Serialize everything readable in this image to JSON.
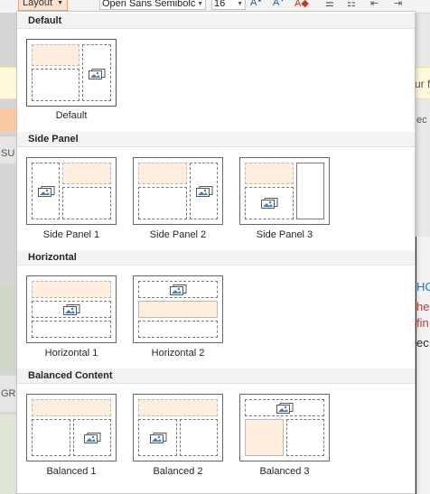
{
  "toolbar": {
    "layout_label": "Layout",
    "font_name": "Open Sans Semibolc",
    "font_size": "16"
  },
  "background": {
    "right_fragments": [
      "ur f",
      "ec",
      "HC",
      "he",
      "fin",
      "ec"
    ],
    "left_fragments": [
      "SU",
      "GR"
    ]
  },
  "gallery": {
    "sections": [
      {
        "title": "Default",
        "items": [
          {
            "label": "Default"
          }
        ]
      },
      {
        "title": "Side Panel",
        "items": [
          {
            "label": "Side Panel 1"
          },
          {
            "label": "Side Panel 2"
          },
          {
            "label": "Side Panel 3"
          }
        ]
      },
      {
        "title": "Horizontal",
        "items": [
          {
            "label": "Horizontal 1"
          },
          {
            "label": "Horizontal 2"
          }
        ]
      },
      {
        "title": "Balanced Content",
        "items": [
          {
            "label": "Balanced 1"
          },
          {
            "label": "Balanced 2"
          },
          {
            "label": "Balanced 3"
          }
        ]
      }
    ]
  },
  "colors": {
    "text_placeholder": "#fdeede",
    "accent_blue": "#2b5797",
    "image_icon_blue": "#3a7ec2"
  }
}
